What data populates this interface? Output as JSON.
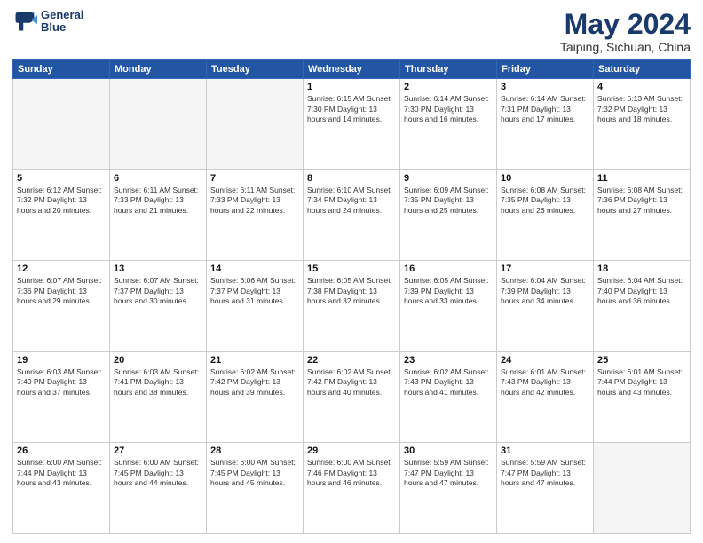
{
  "header": {
    "logo_line1": "General",
    "logo_line2": "Blue",
    "title": "May 2024",
    "location": "Taiping, Sichuan, China"
  },
  "weekdays": [
    "Sunday",
    "Monday",
    "Tuesday",
    "Wednesday",
    "Thursday",
    "Friday",
    "Saturday"
  ],
  "weeks": [
    [
      {
        "day": "",
        "info": ""
      },
      {
        "day": "",
        "info": ""
      },
      {
        "day": "",
        "info": ""
      },
      {
        "day": "1",
        "info": "Sunrise: 6:15 AM\nSunset: 7:30 PM\nDaylight: 13 hours\nand 14 minutes."
      },
      {
        "day": "2",
        "info": "Sunrise: 6:14 AM\nSunset: 7:30 PM\nDaylight: 13 hours\nand 16 minutes."
      },
      {
        "day": "3",
        "info": "Sunrise: 6:14 AM\nSunset: 7:31 PM\nDaylight: 13 hours\nand 17 minutes."
      },
      {
        "day": "4",
        "info": "Sunrise: 6:13 AM\nSunset: 7:32 PM\nDaylight: 13 hours\nand 18 minutes."
      }
    ],
    [
      {
        "day": "5",
        "info": "Sunrise: 6:12 AM\nSunset: 7:32 PM\nDaylight: 13 hours\nand 20 minutes."
      },
      {
        "day": "6",
        "info": "Sunrise: 6:11 AM\nSunset: 7:33 PM\nDaylight: 13 hours\nand 21 minutes."
      },
      {
        "day": "7",
        "info": "Sunrise: 6:11 AM\nSunset: 7:33 PM\nDaylight: 13 hours\nand 22 minutes."
      },
      {
        "day": "8",
        "info": "Sunrise: 6:10 AM\nSunset: 7:34 PM\nDaylight: 13 hours\nand 24 minutes."
      },
      {
        "day": "9",
        "info": "Sunrise: 6:09 AM\nSunset: 7:35 PM\nDaylight: 13 hours\nand 25 minutes."
      },
      {
        "day": "10",
        "info": "Sunrise: 6:08 AM\nSunset: 7:35 PM\nDaylight: 13 hours\nand 26 minutes."
      },
      {
        "day": "11",
        "info": "Sunrise: 6:08 AM\nSunset: 7:36 PM\nDaylight: 13 hours\nand 27 minutes."
      }
    ],
    [
      {
        "day": "12",
        "info": "Sunrise: 6:07 AM\nSunset: 7:36 PM\nDaylight: 13 hours\nand 29 minutes."
      },
      {
        "day": "13",
        "info": "Sunrise: 6:07 AM\nSunset: 7:37 PM\nDaylight: 13 hours\nand 30 minutes."
      },
      {
        "day": "14",
        "info": "Sunrise: 6:06 AM\nSunset: 7:37 PM\nDaylight: 13 hours\nand 31 minutes."
      },
      {
        "day": "15",
        "info": "Sunrise: 6:05 AM\nSunset: 7:38 PM\nDaylight: 13 hours\nand 32 minutes."
      },
      {
        "day": "16",
        "info": "Sunrise: 6:05 AM\nSunset: 7:39 PM\nDaylight: 13 hours\nand 33 minutes."
      },
      {
        "day": "17",
        "info": "Sunrise: 6:04 AM\nSunset: 7:39 PM\nDaylight: 13 hours\nand 34 minutes."
      },
      {
        "day": "18",
        "info": "Sunrise: 6:04 AM\nSunset: 7:40 PM\nDaylight: 13 hours\nand 36 minutes."
      }
    ],
    [
      {
        "day": "19",
        "info": "Sunrise: 6:03 AM\nSunset: 7:40 PM\nDaylight: 13 hours\nand 37 minutes."
      },
      {
        "day": "20",
        "info": "Sunrise: 6:03 AM\nSunset: 7:41 PM\nDaylight: 13 hours\nand 38 minutes."
      },
      {
        "day": "21",
        "info": "Sunrise: 6:02 AM\nSunset: 7:42 PM\nDaylight: 13 hours\nand 39 minutes."
      },
      {
        "day": "22",
        "info": "Sunrise: 6:02 AM\nSunset: 7:42 PM\nDaylight: 13 hours\nand 40 minutes."
      },
      {
        "day": "23",
        "info": "Sunrise: 6:02 AM\nSunset: 7:43 PM\nDaylight: 13 hours\nand 41 minutes."
      },
      {
        "day": "24",
        "info": "Sunrise: 6:01 AM\nSunset: 7:43 PM\nDaylight: 13 hours\nand 42 minutes."
      },
      {
        "day": "25",
        "info": "Sunrise: 6:01 AM\nSunset: 7:44 PM\nDaylight: 13 hours\nand 43 minutes."
      }
    ],
    [
      {
        "day": "26",
        "info": "Sunrise: 6:00 AM\nSunset: 7:44 PM\nDaylight: 13 hours\nand 43 minutes."
      },
      {
        "day": "27",
        "info": "Sunrise: 6:00 AM\nSunset: 7:45 PM\nDaylight: 13 hours\nand 44 minutes."
      },
      {
        "day": "28",
        "info": "Sunrise: 6:00 AM\nSunset: 7:45 PM\nDaylight: 13 hours\nand 45 minutes."
      },
      {
        "day": "29",
        "info": "Sunrise: 6:00 AM\nSunset: 7:46 PM\nDaylight: 13 hours\nand 46 minutes."
      },
      {
        "day": "30",
        "info": "Sunrise: 5:59 AM\nSunset: 7:47 PM\nDaylight: 13 hours\nand 47 minutes."
      },
      {
        "day": "31",
        "info": "Sunrise: 5:59 AM\nSunset: 7:47 PM\nDaylight: 13 hours\nand 47 minutes."
      },
      {
        "day": "",
        "info": ""
      }
    ]
  ]
}
